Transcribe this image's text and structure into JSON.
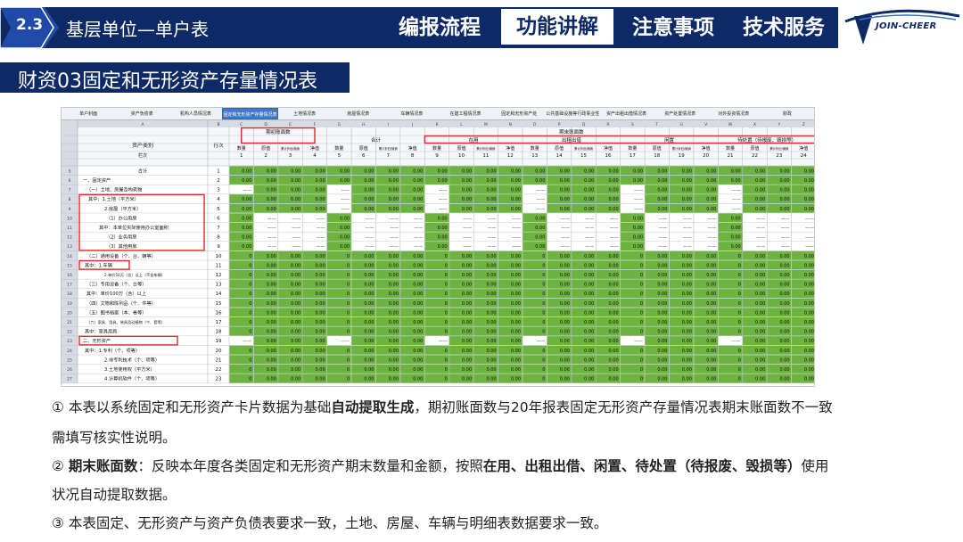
{
  "header": {
    "section_number": "2.3",
    "section_title": "基层单位—单户表",
    "nav": [
      {
        "label": "编报流程"
      },
      {
        "label": "功能讲解"
      },
      {
        "label": "注意事项"
      },
      {
        "label": "技术服务"
      }
    ],
    "logo_text": "JOIN-CHEER"
  },
  "subtitle": "财资03固定和无形资产存量情况表",
  "sheet": {
    "tabs": [
      "单户封面",
      "资产负债表",
      "机构人员情况表",
      "固定和无形资产存量情况表",
      "土地情况表",
      "房屋情况表",
      "车辆情况表",
      "在建工程情况表",
      "固定和无形资产处",
      "公共基础设施等行政事业性国有资产情况表",
      "资产出租出借情况表",
      "资产处置情况表",
      "对外投资情况表",
      "财政"
    ],
    "col_letters": [
      "A",
      "B",
      "C",
      "D",
      "E",
      "F",
      "G",
      "H",
      "I",
      "J",
      "K",
      "L",
      "M",
      "N",
      "O",
      "P",
      "Q",
      "R",
      "S",
      "T",
      "U",
      "V",
      "W",
      "X",
      "Y",
      "Z"
    ],
    "header_labels": {
      "asset_category": "资产类别",
      "line_no": "行次",
      "opening": "期初账面数",
      "closing": "期末账面数",
      "total": "合计",
      "in_use": "在用",
      "rent": "出租出借",
      "idle": "闲置",
      "pending": "待处置（待报废、毁损等）",
      "qty": "数量",
      "orig": "原值",
      "dep": "累计折旧/摊销",
      "net": "净值",
      "seq": "栏次"
    },
    "col_numbers": [
      "1",
      "2",
      "3",
      "4",
      "5",
      "6",
      "7",
      "8",
      "9",
      "10",
      "11",
      "12",
      "13",
      "14",
      "15",
      "16",
      "17",
      "18",
      "19",
      "20",
      "21",
      "22",
      "23",
      "24"
    ],
    "rows": [
      {
        "label": "合计",
        "line": "1"
      },
      {
        "label": "一、固定资产",
        "line": "2"
      },
      {
        "label": "（一）土地、房屋及构筑物",
        "line": "3"
      },
      {
        "label": "其中：1.土地（平方米）",
        "line": "4"
      },
      {
        "label": "2.房屋（平方米）",
        "line": "5"
      },
      {
        "label": "（1）办公用房",
        "line": "6"
      },
      {
        "label": "其中：本单位实际使用办公室面积",
        "line": "7"
      },
      {
        "label": "（2）业务用房",
        "line": "8"
      },
      {
        "label": "（3）其他用房",
        "line": "9"
      },
      {
        "label": "（二）通用设备（个、台、辆等）",
        "line": "10"
      },
      {
        "label": "其中：1.车辆",
        "line": "11"
      },
      {
        "label": "2.单价50万（含）以上（不含车辆）",
        "line": "12"
      },
      {
        "label": "（三）专用设备（个、台等）",
        "line": "13"
      },
      {
        "label": "其中：单价100万（含）以上",
        "line": "14"
      },
      {
        "label": "（四）文物和陈列品（个、件等）",
        "line": "15"
      },
      {
        "label": "（五）图书档案（本、卷等）",
        "line": "16"
      },
      {
        "label": "（六）家具、用具、装具及动植物（个、套等）",
        "line": "17"
      },
      {
        "label": "其中：家具用具",
        "line": "18"
      },
      {
        "label": "二、无形资产",
        "line": "19"
      },
      {
        "label": "其中：1.专利（个、项等）",
        "line": "20"
      },
      {
        "label": "2.非专利技术（个、项等）",
        "line": "21"
      },
      {
        "label": "3.土地使用权（平方米）",
        "line": "22"
      },
      {
        "label": "4.计算机软件（个、项等）",
        "line": "23"
      }
    ],
    "cell_values": {
      "zero": "0.00",
      "int_zero": "0",
      "dash": "——"
    },
    "colors": {
      "green": "#6db33f",
      "highlight": "#e2282c",
      "header_gray": "#d7dce4"
    }
  },
  "notes": [
    {
      "bullet": "①",
      "parts": [
        {
          "t": "本表以系统固定和无形资产卡片数据为基础"
        },
        {
          "t": "自动提取生成",
          "b": true
        },
        {
          "t": "，期初账面数与20年报表固定无形资产存量情况表期末账面数不一致"
        }
      ],
      "continuation": "需填写核实性说明。"
    },
    {
      "bullet": "②",
      "parts": [
        {
          "t": "期末账面数",
          "b": true
        },
        {
          "t": "：反映本年度各类固定和无形资产期末数量和金额，按照"
        },
        {
          "t": "在用、出租出借、闲置、待处置（待报废、毁损等）",
          "b": true
        },
        {
          "t": "使用"
        }
      ],
      "continuation": "状况自动提取数据。"
    },
    {
      "bullet": "③",
      "parts": [
        {
          "t": "本表固定、无形资产与资产负债表要求一致，土地、房屋、车辆与明细表数据要求一致。"
        }
      ],
      "continuation": ""
    }
  ]
}
